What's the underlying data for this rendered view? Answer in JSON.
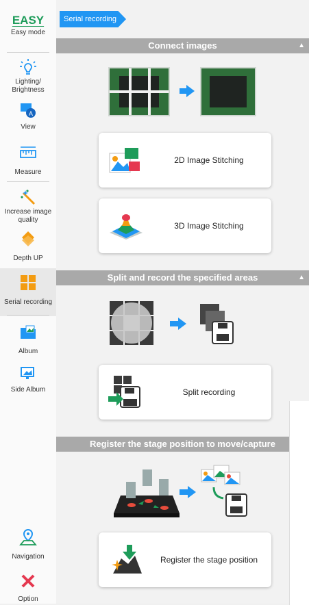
{
  "sidebar": {
    "logo": "EASY",
    "items": [
      {
        "label": "Easy mode"
      },
      {
        "label": "Lighting/ Brightness"
      },
      {
        "label": "View"
      },
      {
        "label": "Measure"
      },
      {
        "label": "Increase image quality"
      },
      {
        "label": "Depth UP"
      },
      {
        "label": "Serial recording"
      },
      {
        "label": "Album"
      },
      {
        "label": "Side Album"
      },
      {
        "label": "Navigation"
      },
      {
        "label": "Option"
      }
    ]
  },
  "breadcrumb": {
    "tag": "Serial recording"
  },
  "sections": [
    {
      "title": "Connect images",
      "cards": [
        "2D Image Stitching",
        "3D Image Stitching"
      ]
    },
    {
      "title": "Split and record the specified areas",
      "cards": [
        "Split recording"
      ]
    },
    {
      "title": "Register the stage position to move/capture",
      "cards": [
        "Register the stage position"
      ]
    }
  ],
  "colors": {
    "accent": "#2196f3",
    "section_bar": "#a9a9a9",
    "easy": "#1e9c5a",
    "icon_orange": "#f39c12"
  }
}
